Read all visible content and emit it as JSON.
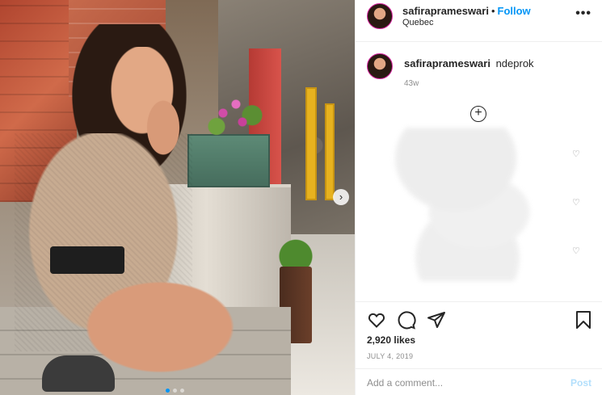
{
  "post": {
    "username": "safiraprameswari",
    "follow_label": "Follow",
    "separator": "•",
    "location": "Quebec",
    "more_label": "•••",
    "caption_username": "safiraprameswari",
    "caption_text": "ndeprok",
    "caption_time": "43w",
    "likes": "2,920 likes",
    "date": "JULY 4, 2019"
  },
  "comment_box": {
    "placeholder": "Add a comment...",
    "post_label": "Post"
  },
  "icons": {
    "more": "more-options-icon",
    "load_more": "plus-circle-icon",
    "like": "heart-icon",
    "comment": "comment-bubble-icon",
    "share": "paper-plane-icon",
    "save": "bookmark-icon",
    "comment_like": "small-heart-icon",
    "next": "chevron-right-icon"
  },
  "colors": {
    "follow": "#0095f6",
    "post_disabled": "#b2dffc",
    "muted": "#8e8e8e"
  },
  "carousel": {
    "slides": 3,
    "active": 1
  }
}
